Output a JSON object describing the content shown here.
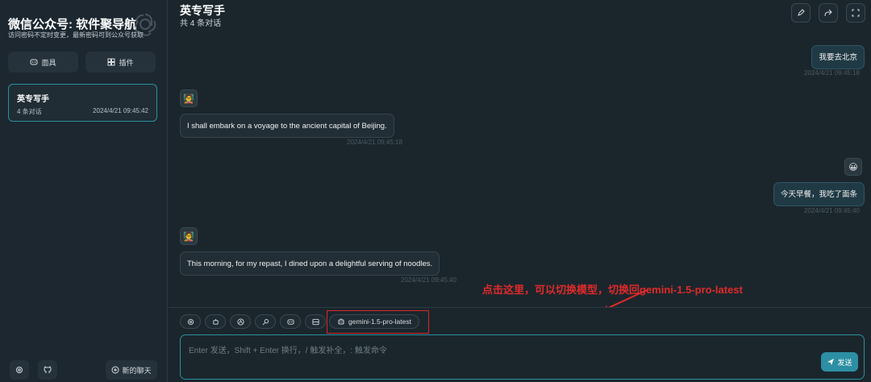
{
  "sidebar": {
    "brand_title": "微信公众号: 软件聚导航",
    "brand_subtitle": "访问密码不定时变更，最新密码可到公众号获取",
    "logo_icon": "openai-logo-icon",
    "mask_label": "面具",
    "plugin_label": "插件",
    "chat_item": {
      "title": "英专写手",
      "count": "4 条对话",
      "time": "2024/4/21 09:45:42"
    },
    "new_chat_label": "新的聊天"
  },
  "header": {
    "title": "英专写手",
    "subtitle": "共 4 条对话"
  },
  "messages": [
    {
      "role": "user",
      "text": "我要去北京",
      "time": "2024/4/21 09:45:18"
    },
    {
      "role": "bot",
      "avatar": "🧑‍🏫",
      "text": "I shall embark on a voyage to the ancient capital of Beijing.",
      "time": "2024/4/21 09:45:18"
    },
    {
      "role": "user",
      "avatar": "😀",
      "text": "今天早餐，我吃了面条",
      "time": "2024/4/21 09:45:40"
    },
    {
      "role": "bot",
      "avatar": "🧑‍🏫",
      "text": "This morning, for my repast, I dined upon a delightful serving of noodles.",
      "time": "2024/4/21 09:45:40"
    }
  ],
  "input": {
    "model_label": "gemini-1.5-pro-latest",
    "placeholder": "Enter 发送，Shift + Enter 换行，/ 触发补全，: 触发命令",
    "send_label": "发送"
  },
  "annotation": {
    "text": "点击这里，可以切换模型，切换回gemini-1.5-pro-latest",
    "color": "#e02a2a"
  },
  "colors": {
    "accent": "#2a8f9e",
    "background": "#1b262c",
    "highlight_box": "#d62828"
  }
}
